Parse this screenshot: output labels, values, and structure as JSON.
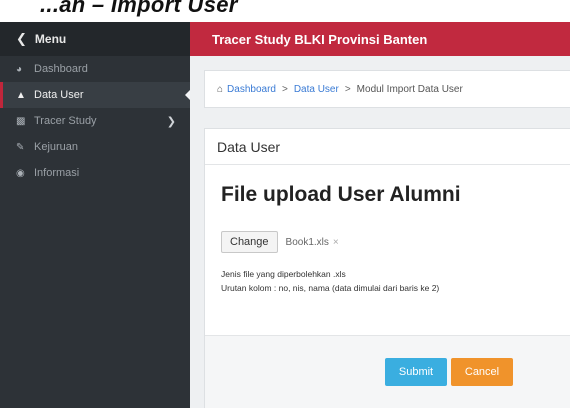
{
  "caption": {
    "text": "...an – Import User"
  },
  "sidebar": {
    "menu_label": "Menu",
    "items": [
      {
        "label": "Dashboard",
        "icon": "dashboard-icon"
      },
      {
        "label": "Data User",
        "icon": "user-icon",
        "active": true
      },
      {
        "label": "Tracer Study",
        "icon": "chart-icon",
        "has_children": true
      },
      {
        "label": "Kejuruan",
        "icon": "pencil-icon"
      },
      {
        "label": "Informasi",
        "icon": "globe-icon"
      }
    ]
  },
  "topbar": {
    "title": "Tracer Study BLKI Provinsi Banten"
  },
  "breadcrumb": {
    "items": [
      "Dashboard",
      "Data User",
      "Modul Import Data User"
    ]
  },
  "panel": {
    "title": "Data User",
    "upload_title": "File upload User Alumni",
    "change_label": "Change",
    "file_name": "Book1.xls",
    "file_remove": "×",
    "note1": "Jenis file yang diperbolehkan .xls",
    "note2": "Urutan kolom : no, nis, nama (data dimulai dari baris ke 2)",
    "submit_label": "Submit",
    "cancel_label": "Cancel"
  },
  "colors": {
    "topbar": "#c1293f",
    "sidebar": "#2d3237",
    "submit": "#3aaee0",
    "cancel": "#f0932b"
  }
}
